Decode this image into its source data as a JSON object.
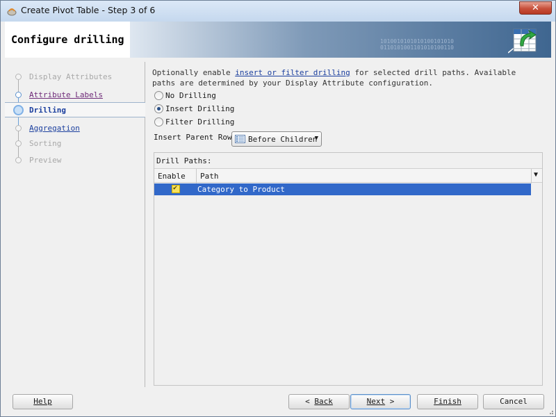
{
  "window": {
    "title": "Create Pivot Table - Step 3 of 6",
    "close_label": "✕"
  },
  "header": {
    "title": "Configure drilling",
    "binary_line1": "1010010101010100101010",
    "binary_line2": "0110101001101010100110"
  },
  "nav": {
    "items": [
      {
        "label": "Display Attributes",
        "state": "disabled"
      },
      {
        "label": "Attribute Labels",
        "state": "visited"
      },
      {
        "label": "Drilling",
        "state": "current"
      },
      {
        "label": "Aggregation",
        "state": "link"
      },
      {
        "label": "Sorting",
        "state": "disabled"
      },
      {
        "label": "Preview",
        "state": "disabled"
      }
    ]
  },
  "content": {
    "description_pre": "Optionally enable ",
    "description_link": "insert or filter drilling",
    "description_post": " for selected drill paths. Available paths are determined by your Display Attribute configuration.",
    "options": [
      {
        "label": "No Drilling",
        "selected": false
      },
      {
        "label": "Insert Drilling",
        "selected": true
      },
      {
        "label": "Filter Drilling",
        "selected": false
      }
    ],
    "parent_row_label": "Insert Parent Row:",
    "parent_row_value": "Before Children",
    "drill_paths_label": "Drill Paths:",
    "columns": {
      "enable": "Enable",
      "path": "Path"
    },
    "rows": [
      {
        "enabled": true,
        "path": "Category to Product"
      }
    ]
  },
  "buttons": {
    "help": "Help",
    "back": "Back",
    "next": "Next",
    "finish": "Finish",
    "cancel": "Cancel"
  },
  "colors": {
    "selection": "#3168c9",
    "link": "#1b3f9e",
    "checkbox": "#f8e25a"
  }
}
